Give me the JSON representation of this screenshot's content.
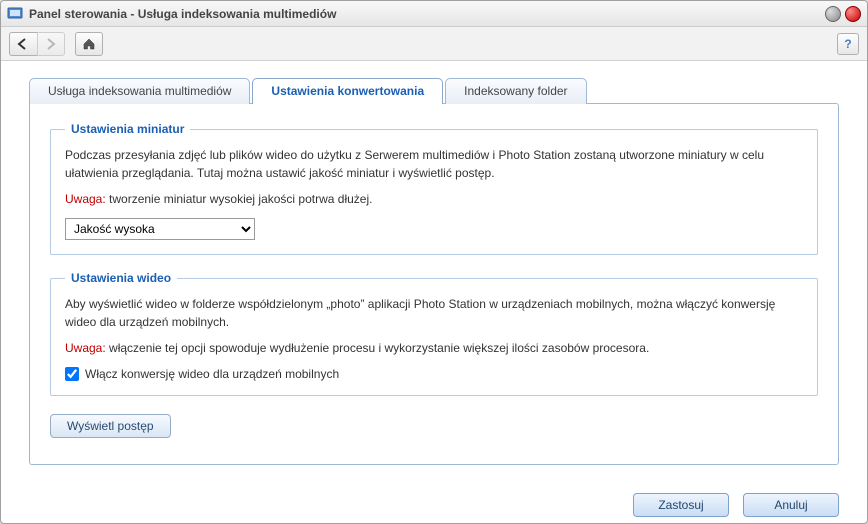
{
  "window": {
    "title": "Panel sterowania - Usługa indeksowania multimediów"
  },
  "toolbar": {
    "help": "?"
  },
  "tabs": [
    {
      "label": "Usługa indeksowania multimediów"
    },
    {
      "label": "Ustawienia konwertowania"
    },
    {
      "label": "Indeksowany folder"
    }
  ],
  "thumbnail": {
    "legend": "Ustawienia miniatur",
    "desc": "Podczas przesyłania zdjęć lub plików wideo do użytku z Serwerem multimediów i Photo Station zostaną utworzone miniatury w celu ułatwienia przeglądania. Tutaj można ustawić jakość miniatur i wyświetlić postęp.",
    "warn_label": "Uwaga:",
    "warn_text": "tworzenie miniatur wysokiej jakości potrwa dłużej.",
    "quality_selected": "Jakość wysoka"
  },
  "video": {
    "legend": "Ustawienia wideo",
    "desc": "Aby wyświetlić wideo w folderze współdzielonym „photo” aplikacji Photo Station w urządzeniach mobilnych, można włączyć konwersję wideo dla urządzeń mobilnych.",
    "warn_label": "Uwaga:",
    "warn_text": "włączenie tej opcji spowoduje wydłużenie procesu i wykorzystanie większej ilości zasobów procesora.",
    "checkbox_label": "Włącz konwersję wideo dla urządzeń mobilnych"
  },
  "buttons": {
    "progress": "Wyświetl postęp",
    "apply": "Zastosuj",
    "cancel": "Anuluj"
  }
}
